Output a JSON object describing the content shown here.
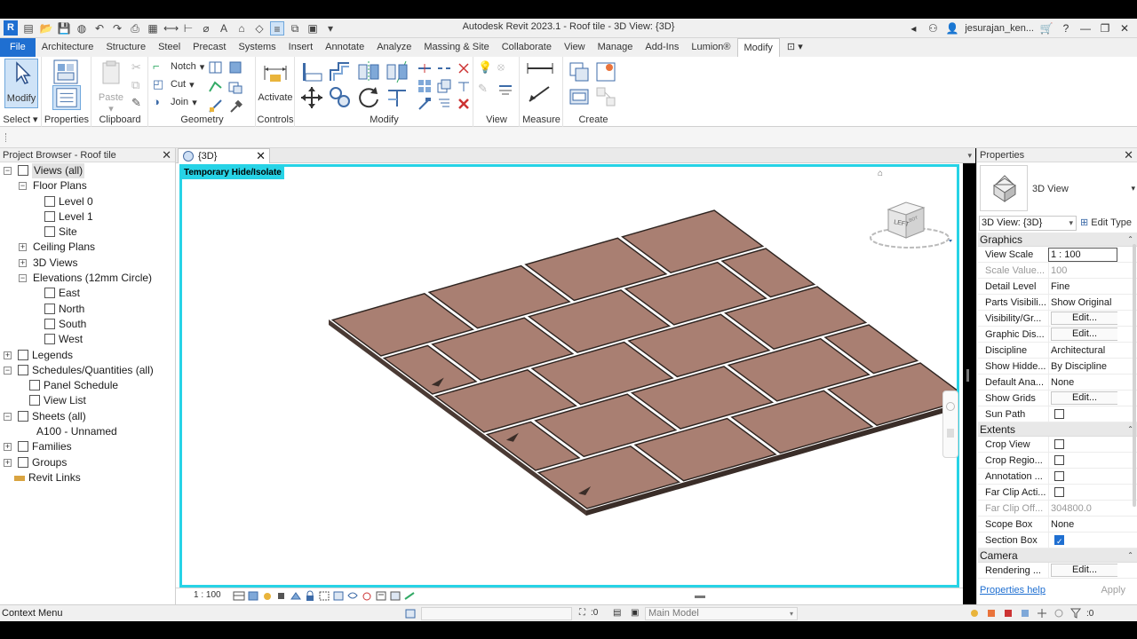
{
  "app": {
    "title": "Autodesk Revit 2023.1 - Roof tile - 3D View: {3D}",
    "logo_letter": "R",
    "user": "jesurajan_ken...",
    "qat_icons": [
      "open-file-icon",
      "new-icon",
      "open-icon",
      "save-icon",
      "sync-icon",
      "undo-icon",
      "redo-icon",
      "print-icon",
      "pdf-icon",
      "measure-icon",
      "align-dim-icon",
      "tag-icon",
      "text-icon",
      "a-icon",
      "3d-view-icon",
      "section-icon",
      "thin-lines-icon",
      "switch-windows-icon"
    ]
  },
  "ribbon": {
    "tabs": [
      "File",
      "Architecture",
      "Structure",
      "Steel",
      "Precast",
      "Systems",
      "Insert",
      "Annotate",
      "Analyze",
      "Massing & Site",
      "Collaborate",
      "View",
      "Manage",
      "Add-Ins",
      "Lumion®",
      "Modify"
    ],
    "active_tab": "Modify",
    "select_panel": {
      "button": "Modify",
      "label": "Select"
    },
    "properties_panel": {
      "label": "Properties"
    },
    "clipboard_panel": {
      "paste": "Paste",
      "label": "Clipboard"
    },
    "geometry_panel": {
      "notch": "Notch",
      "cut": "Cut",
      "join": "Join",
      "label": "Geometry"
    },
    "controls_panel": {
      "activate": "Activate",
      "label": "Controls"
    },
    "modify_panel": {
      "label": "Modify"
    },
    "view_panel": {
      "label": "View"
    },
    "measure_panel": {
      "label": "Measure"
    },
    "create_panel": {
      "label": "Create"
    }
  },
  "browser": {
    "title": "Project Browser - Roof tile",
    "tree": [
      {
        "label": "Views (all)",
        "level": 0,
        "expander": "−",
        "selected": true,
        "icon": "views-icon"
      },
      {
        "label": "Floor Plans",
        "level": 1,
        "expander": "−"
      },
      {
        "label": "Level 0",
        "level": 2,
        "icon": "view-icon"
      },
      {
        "label": "Level 1",
        "level": 2,
        "icon": "view-icon"
      },
      {
        "label": "Site",
        "level": 2,
        "icon": "view-icon"
      },
      {
        "label": "Ceiling Plans",
        "level": 1,
        "expander": "+"
      },
      {
        "label": "3D Views",
        "level": 1,
        "expander": "+"
      },
      {
        "label": "Elevations (12mm Circle)",
        "level": 1,
        "expander": "−"
      },
      {
        "label": "East",
        "level": 2,
        "icon": "view-icon"
      },
      {
        "label": "North",
        "level": 2,
        "icon": "view-icon"
      },
      {
        "label": "South",
        "level": 2,
        "icon": "view-icon"
      },
      {
        "label": "West",
        "level": 2,
        "icon": "view-icon"
      },
      {
        "label": "Legends",
        "level": 0,
        "expander": "+",
        "icon": "legend-icon"
      },
      {
        "label": "Schedules/Quantities (all)",
        "level": 0,
        "expander": "−",
        "icon": "schedule-icon"
      },
      {
        "label": "Panel Schedule",
        "level": 1,
        "icon": "view-icon"
      },
      {
        "label": "View List",
        "level": 1,
        "icon": "view-icon"
      },
      {
        "label": "Sheets (all)",
        "level": 0,
        "expander": "−",
        "icon": "sheet-icon"
      },
      {
        "label": "A100 - Unnamed",
        "level": 1
      },
      {
        "label": "Families",
        "level": 0,
        "expander": "+",
        "icon": "families-icon"
      },
      {
        "label": "Groups",
        "level": 0,
        "expander": "+",
        "icon": "groups-icon"
      },
      {
        "label": "Revit Links",
        "level": 0,
        "icon": "links-icon"
      }
    ]
  },
  "view": {
    "tab_label": "{3D}",
    "hide_isolate": "Temporary Hide/Isolate",
    "scale": "1 : 100",
    "viewcube_face": "LEFT",
    "viewcube_face2": "BOT"
  },
  "properties": {
    "title": "Properties",
    "type_name": "3D View",
    "instance": "3D View: {3D}",
    "edit_type": "Edit Type",
    "groups": [
      {
        "name": "Graphics",
        "rows": [
          {
            "name": "View Scale",
            "value": "1 : 100",
            "kind": "box"
          },
          {
            "name": "Scale Value...",
            "value": "100",
            "kind": "dim"
          },
          {
            "name": "Detail Level",
            "value": "Fine"
          },
          {
            "name": "Parts Visibili...",
            "value": "Show Original"
          },
          {
            "name": "Visibility/Gr...",
            "value": "Edit...",
            "kind": "button"
          },
          {
            "name": "Graphic Dis...",
            "value": "Edit...",
            "kind": "button"
          },
          {
            "name": "Discipline",
            "value": "Architectural"
          },
          {
            "name": "Show Hidde...",
            "value": "By Discipline"
          },
          {
            "name": "Default Ana...",
            "value": "None"
          },
          {
            "name": "Show Grids",
            "value": "Edit...",
            "kind": "button"
          },
          {
            "name": "Sun Path",
            "value": "",
            "kind": "check",
            "checked": false
          }
        ]
      },
      {
        "name": "Extents",
        "rows": [
          {
            "name": "Crop View",
            "value": "",
            "kind": "check",
            "checked": false
          },
          {
            "name": "Crop Regio...",
            "value": "",
            "kind": "check",
            "checked": false
          },
          {
            "name": "Annotation ...",
            "value": "",
            "kind": "check",
            "checked": false
          },
          {
            "name": "Far Clip Acti...",
            "value": "",
            "kind": "check",
            "checked": false
          },
          {
            "name": "Far Clip Off...",
            "value": "304800.0",
            "kind": "dim"
          },
          {
            "name": "Scope Box",
            "value": "None"
          },
          {
            "name": "Section Box",
            "value": "",
            "kind": "check",
            "checked": true
          }
        ]
      },
      {
        "name": "Camera",
        "rows": [
          {
            "name": "Rendering ...",
            "value": "Edit...",
            "kind": "button"
          }
        ]
      }
    ],
    "help": "Properties help",
    "apply": "Apply"
  },
  "status": {
    "context": "Context Menu",
    "selection_count": ":0",
    "model": "Main Model",
    "filter_count": ":0"
  },
  "colors": {
    "accent": "#1f6fd1",
    "isolate": "#27d3e6",
    "tile": "#a97f72"
  }
}
